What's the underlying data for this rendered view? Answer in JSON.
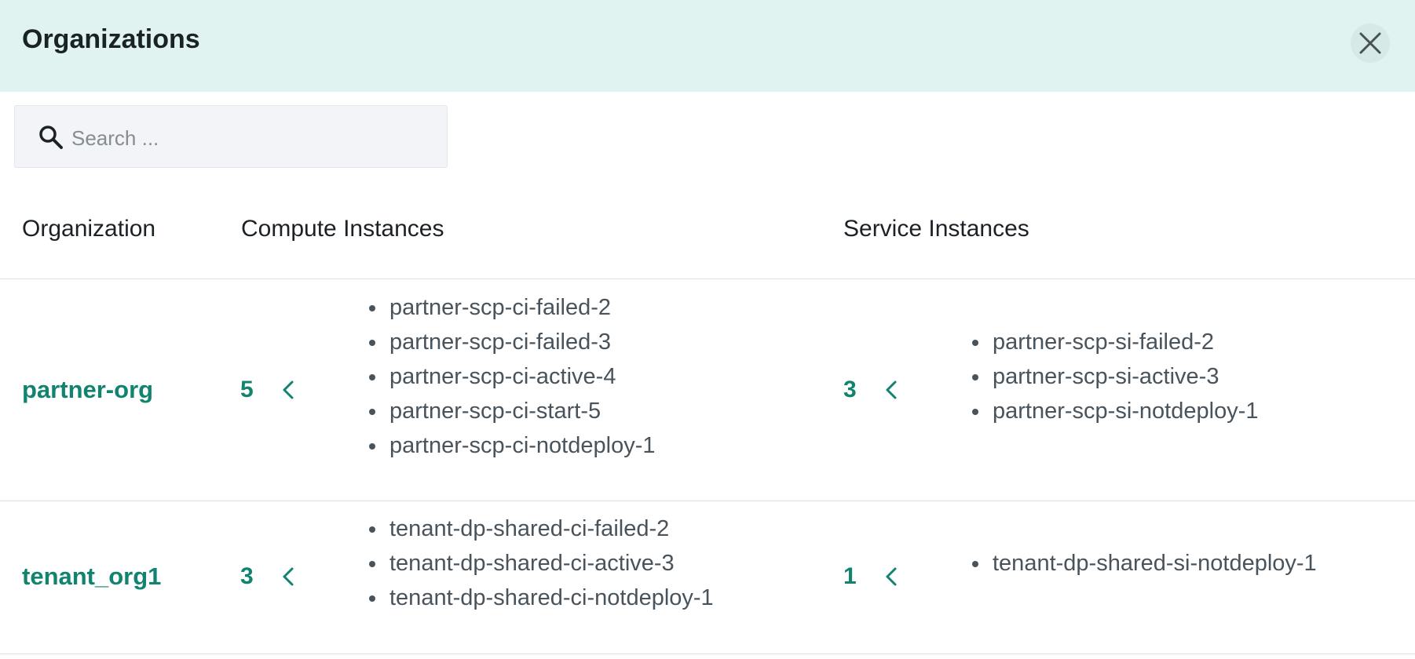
{
  "header": {
    "title": "Organizations",
    "close_icon": "close-icon"
  },
  "search": {
    "placeholder": "Search ...",
    "value": "",
    "icon": "search-icon"
  },
  "table": {
    "columns": {
      "organization": "Organization",
      "compute": "Compute Instances",
      "service": "Service Instances"
    },
    "rows": [
      {
        "org": "partner-org",
        "compute_count": "5",
        "compute_instances": [
          "partner-scp-ci-failed-2",
          "partner-scp-ci-failed-3",
          "partner-scp-ci-active-4",
          "partner-scp-ci-start-5",
          "partner-scp-ci-notdeploy-1"
        ],
        "service_count": "3",
        "service_instances": [
          "partner-scp-si-failed-2",
          "partner-scp-si-active-3",
          "partner-scp-si-notdeploy-1"
        ]
      },
      {
        "org": "tenant_org1",
        "compute_count": "3",
        "compute_instances": [
          "tenant-dp-shared-ci-failed-2",
          "tenant-dp-shared-ci-active-3",
          "tenant-dp-shared-ci-notdeploy-1"
        ],
        "service_count": "1",
        "service_instances": [
          "tenant-dp-shared-si-notdeploy-1"
        ]
      }
    ]
  },
  "colors": {
    "header_bg": "#e0f3f1",
    "accent": "#11846f",
    "text": "#1b2227",
    "muted_text": "#48535c"
  }
}
